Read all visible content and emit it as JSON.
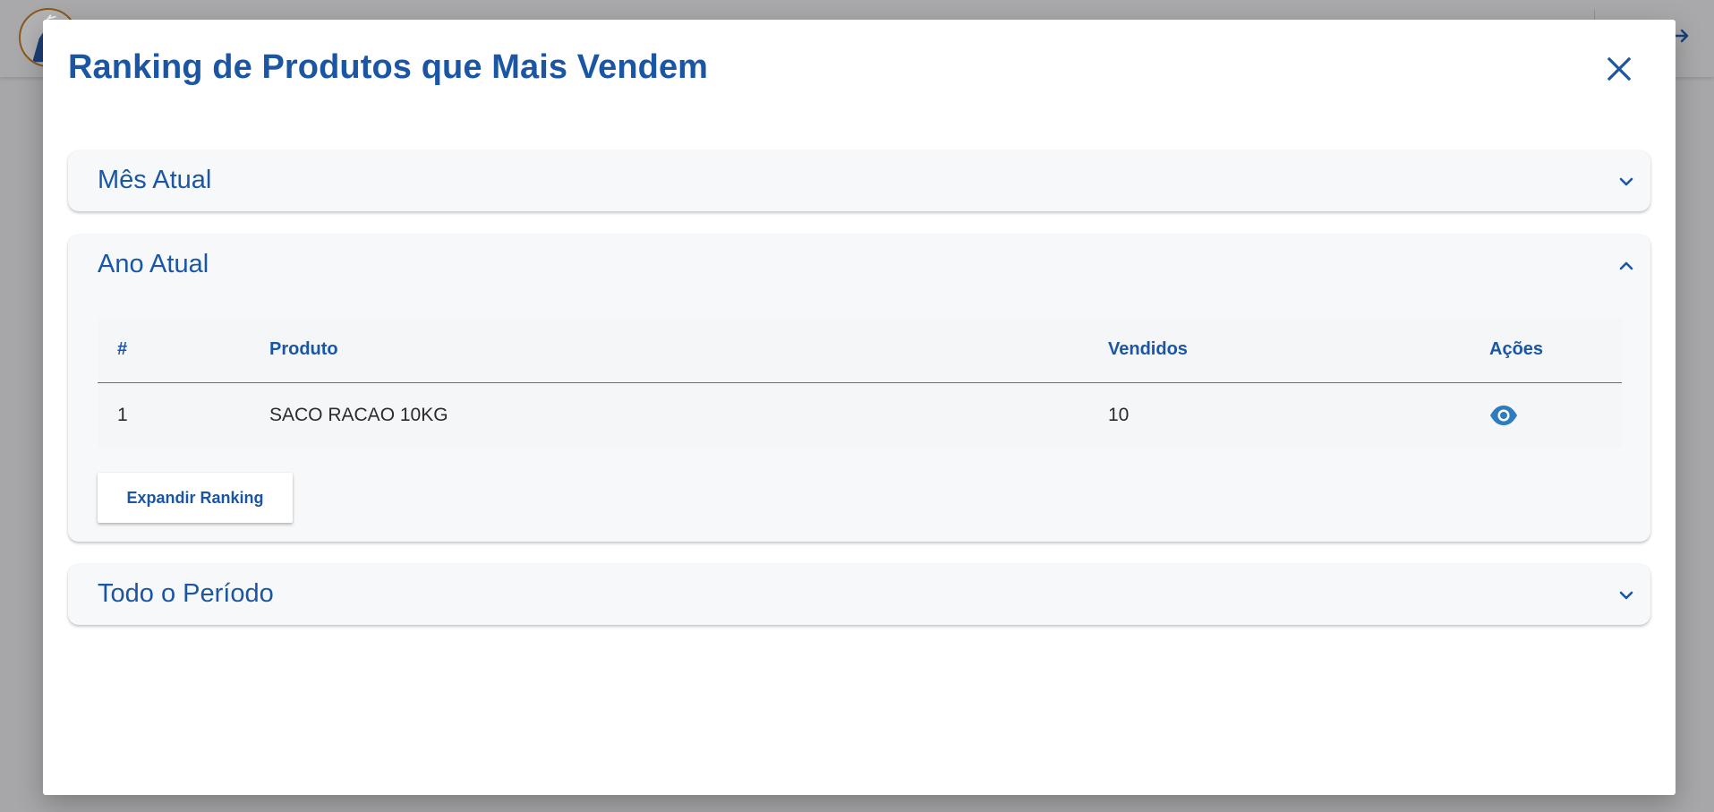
{
  "modal": {
    "title": "Ranking de Produtos que Mais Vendem"
  },
  "panels": [
    {
      "title": "Mês Atual",
      "expanded": false
    },
    {
      "title": "Ano Atual",
      "expanded": true
    },
    {
      "title": "Todo o Período",
      "expanded": false
    }
  ],
  "table": {
    "headers": [
      "#",
      "Produto",
      "Vendidos",
      "Ações"
    ],
    "rows": [
      {
        "rank": "1",
        "product": "SACO RACAO 10KG",
        "sold": "10",
        "action_icon": "eye-icon"
      }
    ]
  },
  "expand_button": {
    "label": "Expandir Ranking"
  },
  "colors": {
    "primary": "#1a56a4",
    "overlay": "#a7a7a9",
    "panel_bg": "#f7f8fa",
    "eye_icon": "#2e7bbd"
  },
  "icons": {
    "close": "close-icon",
    "collapsed": "chevron-down-icon",
    "expanded": "chevron-up-icon",
    "background_action": "arrow-right-icon"
  }
}
